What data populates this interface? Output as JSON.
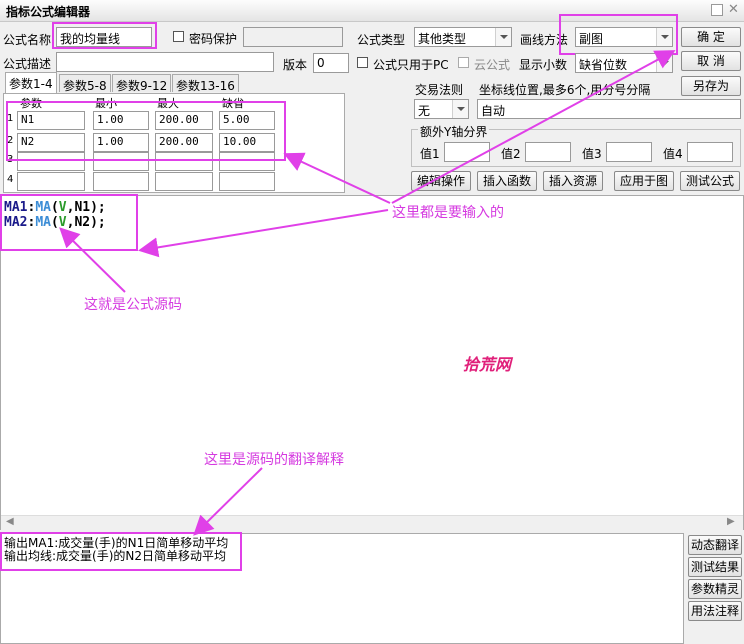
{
  "window": {
    "title": "指标公式编辑器"
  },
  "form": {
    "name_label": "公式名称",
    "name_value": "我的均量线",
    "password_label": "密码保护",
    "type_label": "公式类型",
    "type_value": "其他类型",
    "draw_label": "画线方法",
    "draw_value": "副图",
    "desc_label": "公式描述",
    "version_label": "版本",
    "version_value": "0",
    "pc_only_label": "公式只用于PC",
    "cloud_label": "云公式",
    "decimals_label": "显示小数",
    "decimals_value": "缺省位数"
  },
  "buttons": {
    "ok": "确  定",
    "cancel": "取  消",
    "save_as": "另存为",
    "edit_ops": "编辑操作",
    "insert_func": "插入函数",
    "insert_res": "插入资源",
    "apply_chart": "应用于图",
    "test_formula": "测试公式",
    "dyn_translate": "动态翻译",
    "test_result": "测试结果",
    "param_wizard": "参数精灵",
    "usage_notes": "用法注释"
  },
  "tabs": [
    "参数1-4",
    "参数5-8",
    "参数9-12",
    "参数13-16"
  ],
  "param_headers": [
    "参数",
    "最小",
    "最大",
    "缺省"
  ],
  "params": [
    {
      "idx": "1",
      "name": "N1",
      "min": "1.00",
      "max": "200.00",
      "def": "5.00"
    },
    {
      "idx": "2",
      "name": "N2",
      "min": "1.00",
      "max": "200.00",
      "def": "10.00"
    },
    {
      "idx": "3",
      "name": "",
      "min": "",
      "max": "",
      "def": ""
    },
    {
      "idx": "4",
      "name": "",
      "min": "",
      "max": "",
      "def": ""
    }
  ],
  "trade": {
    "rule_label": "交易法则",
    "rule_value": "无",
    "coord_label": "坐标线位置,最多6个,用分号分隔",
    "coord_value": "自动",
    "yaxis_label": "额外Y轴分界",
    "v1": "值1",
    "v2": "值2",
    "v3": "值3",
    "v4": "值4"
  },
  "code_lines": [
    {
      "def": "MA1",
      "colon": ":",
      "fn": "MA",
      "open": "(",
      "v": "V",
      "rest": ",N1);"
    },
    {
      "def": "MA2",
      "colon": ":",
      "fn": "MA",
      "open": "(",
      "v": "V",
      "rest": ",N2);"
    }
  ],
  "explanation": [
    "输出MA1:成交量(手)的N1日简单移动平均",
    "输出均线:成交量(手)的N2日简单移动平均"
  ],
  "annotations": {
    "input_note": "这里都是要输入的",
    "source_note": "这就是公式源码",
    "translate_note": "这里是源码的翻译解释",
    "watermark": "拾荒网"
  },
  "colors": {
    "highlight": "#e040e8",
    "annotation": "#d53ae0"
  }
}
